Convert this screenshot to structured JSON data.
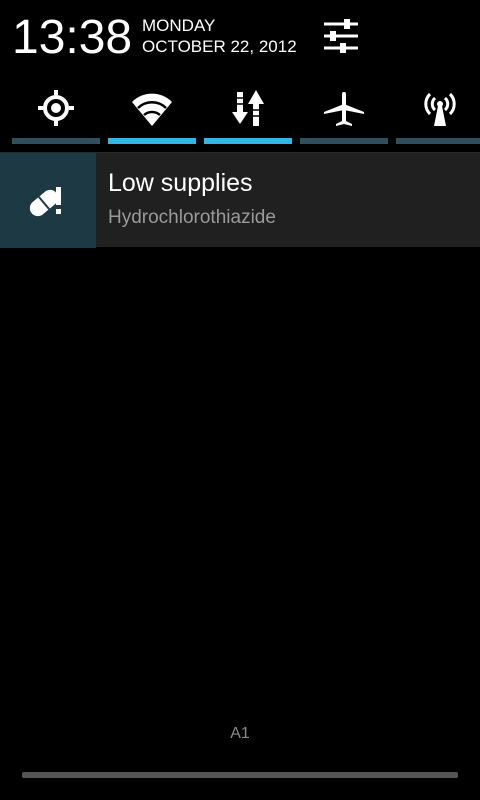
{
  "header": {
    "time": "13:38",
    "day": "MONDAY",
    "date": "OCTOBER 22, 2012",
    "settings_icon": "settings-sliders-icon"
  },
  "quick_toggles": [
    {
      "name": "brightness",
      "icon": "brightness-icon",
      "state": "off"
    },
    {
      "name": "wifi",
      "icon": "wifi-icon",
      "state": "on"
    },
    {
      "name": "mobile-data",
      "icon": "data-transfer-icon",
      "state": "on"
    },
    {
      "name": "airplane-mode",
      "icon": "airplane-icon",
      "state": "off"
    },
    {
      "name": "hotspot",
      "icon": "broadcast-icon",
      "state": "off"
    }
  ],
  "notification": {
    "title": "Low supplies",
    "text": "Hydrochlorothiazide",
    "icon": "pill-alert-icon"
  },
  "carrier": "A1",
  "colors": {
    "accent": "#33b5e5",
    "toggle_off": "#2f4f5a",
    "notification_bg": "#202020",
    "notification_icon_bg": "#1d3a44"
  }
}
